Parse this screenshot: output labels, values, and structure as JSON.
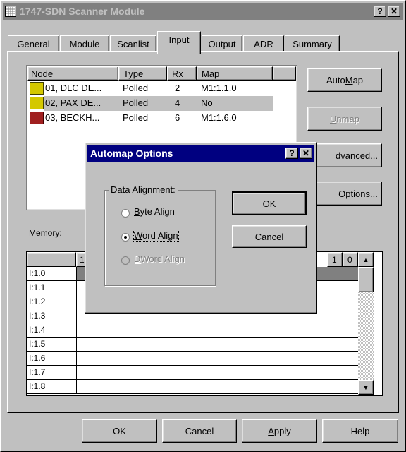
{
  "window": {
    "title": "1747-SDN Scanner Module",
    "help_btn": "?",
    "close_btn": "✕"
  },
  "tabs": [
    "General",
    "Module",
    "Scanlist",
    "Input",
    "Output",
    "ADR",
    "Summary"
  ],
  "nodes": {
    "headers": [
      "Node",
      "Type",
      "Rx",
      "Map"
    ],
    "rows": [
      {
        "node": "01, DLC DE...",
        "type": "Polled",
        "rx": "2",
        "map": "M1:1.1.0"
      },
      {
        "node": "02, PAX DE...",
        "type": "Polled",
        "rx": "4",
        "map": "No"
      },
      {
        "node": "03, BECKH...",
        "type": "Polled",
        "rx": "6",
        "map": "M1:1.6.0"
      }
    ]
  },
  "side_buttons": {
    "automap_pre": "Auto",
    "automap_u": "M",
    "automap_post": "ap",
    "unmap_u": "U",
    "unmap_post": "nmap",
    "advanced_vis": "dvanced...",
    "options_u": "O",
    "options_post": "ptions..."
  },
  "memory": {
    "label_pre": "M",
    "label_u": "e",
    "label_post": "mory:",
    "col_1": "1",
    "col_right_1": "1",
    "col_right_0": "0",
    "rows": [
      "I:1.0",
      "I:1.1",
      "I:1.2",
      "I:1.3",
      "I:1.4",
      "I:1.5",
      "I:1.6",
      "I:1.7",
      "I:1.8"
    ]
  },
  "bottom_buttons": {
    "ok": "OK",
    "cancel": "Cancel",
    "apply_u": "A",
    "apply_post": "pply",
    "help": "Help"
  },
  "dialog": {
    "title": "Automap Options",
    "help_btn": "?",
    "close_btn": "✕",
    "group_label": "Data Alignment:",
    "byte_u": "B",
    "byte_post": "yte Align",
    "word_u": "W",
    "word_post": "ord Align",
    "dword_u": "D",
    "dword_post": "Word Align",
    "ok": "OK",
    "cancel": "Cancel"
  },
  "colors": {
    "active_title": "#000080",
    "inactive_title": "#808080",
    "face": "#c0c0c0",
    "selected_row": "#c0c0c0"
  }
}
